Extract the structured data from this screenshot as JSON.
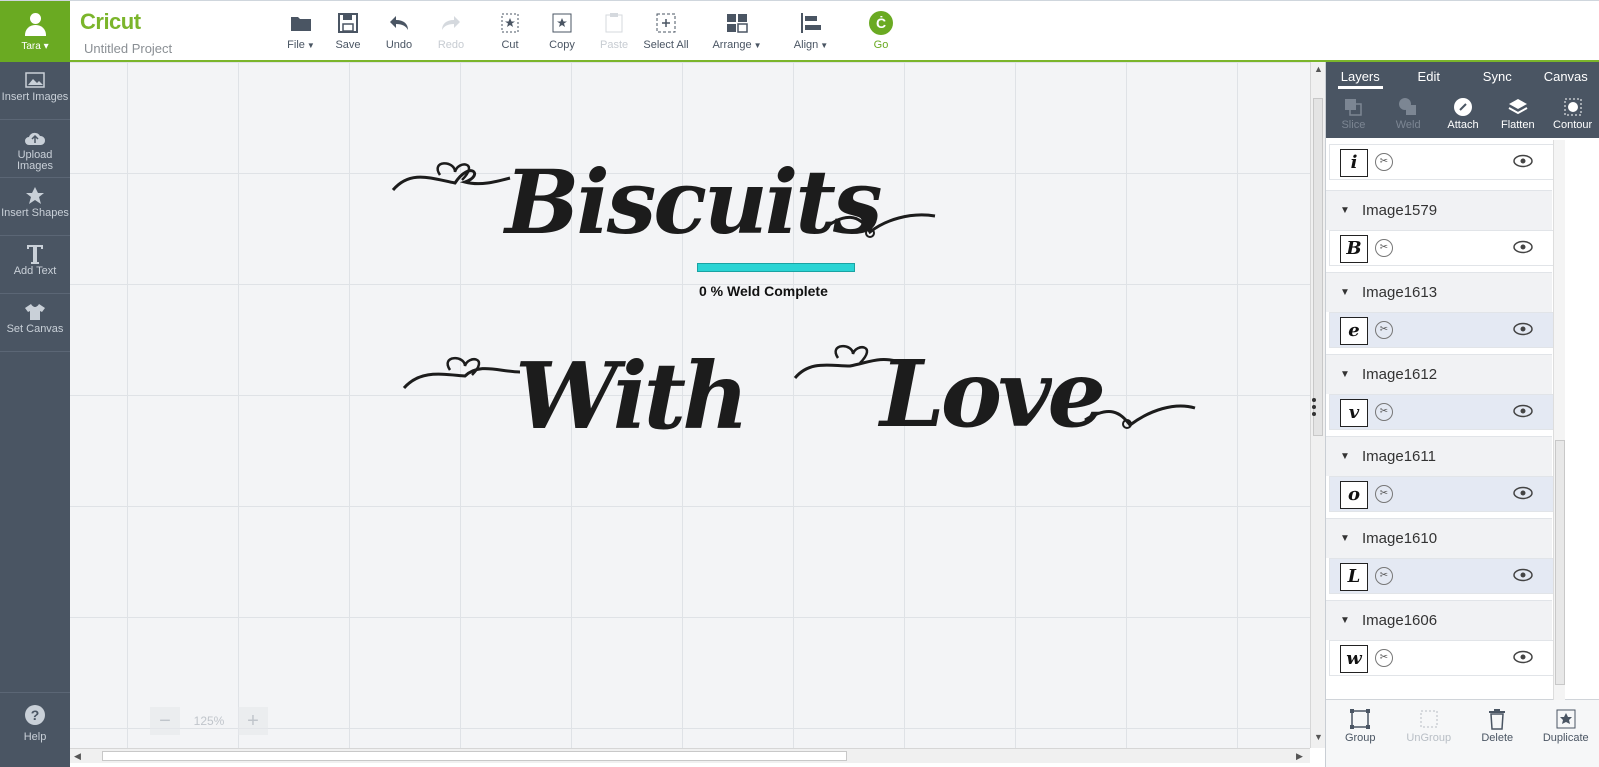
{
  "user": {
    "name": "Tara"
  },
  "app": {
    "logo": "Cricut",
    "project_name": "Untitled Project"
  },
  "toolbar": {
    "file": "File",
    "save": "Save",
    "undo": "Undo",
    "redo": "Redo",
    "cut": "Cut",
    "copy": "Copy",
    "paste": "Paste",
    "select_all": "Select All",
    "arrange": "Arrange",
    "align": "Align",
    "go": "Go"
  },
  "sidebar": {
    "insert_images": "Insert Images",
    "upload_images": "Upload Images",
    "insert_shapes": "Insert Shapes",
    "add_text": "Add Text",
    "set_canvas": "Set Canvas",
    "help": "Help"
  },
  "canvas": {
    "word1": "Biscuits",
    "word2": "With",
    "word3": "Love",
    "weld_status": "0 % Weld Complete",
    "weld_progress": 0,
    "zoom": "125%"
  },
  "panel": {
    "tabs": [
      "Layers",
      "Edit",
      "Sync",
      "Canvas"
    ],
    "tools": {
      "slice": "Slice",
      "weld": "Weld",
      "attach": "Attach",
      "flatten": "Flatten",
      "contour": "Contour"
    },
    "layers": [
      {
        "name": "",
        "glyph": "i"
      },
      {
        "name": "Image1579",
        "glyph": "B"
      },
      {
        "name": "Image1613",
        "glyph": "e"
      },
      {
        "name": "Image1612",
        "glyph": "v"
      },
      {
        "name": "Image1611",
        "glyph": "o"
      },
      {
        "name": "Image1610",
        "glyph": "L"
      },
      {
        "name": "Image1606",
        "glyph": "w"
      }
    ],
    "footer": {
      "group": "Group",
      "ungroup": "UnGroup",
      "delete": "Delete",
      "duplicate": "Duplicate"
    }
  },
  "colors": {
    "brand": "#6aaa22",
    "sidebar": "#4a5563",
    "weld_bar": "#2ad4d4"
  }
}
